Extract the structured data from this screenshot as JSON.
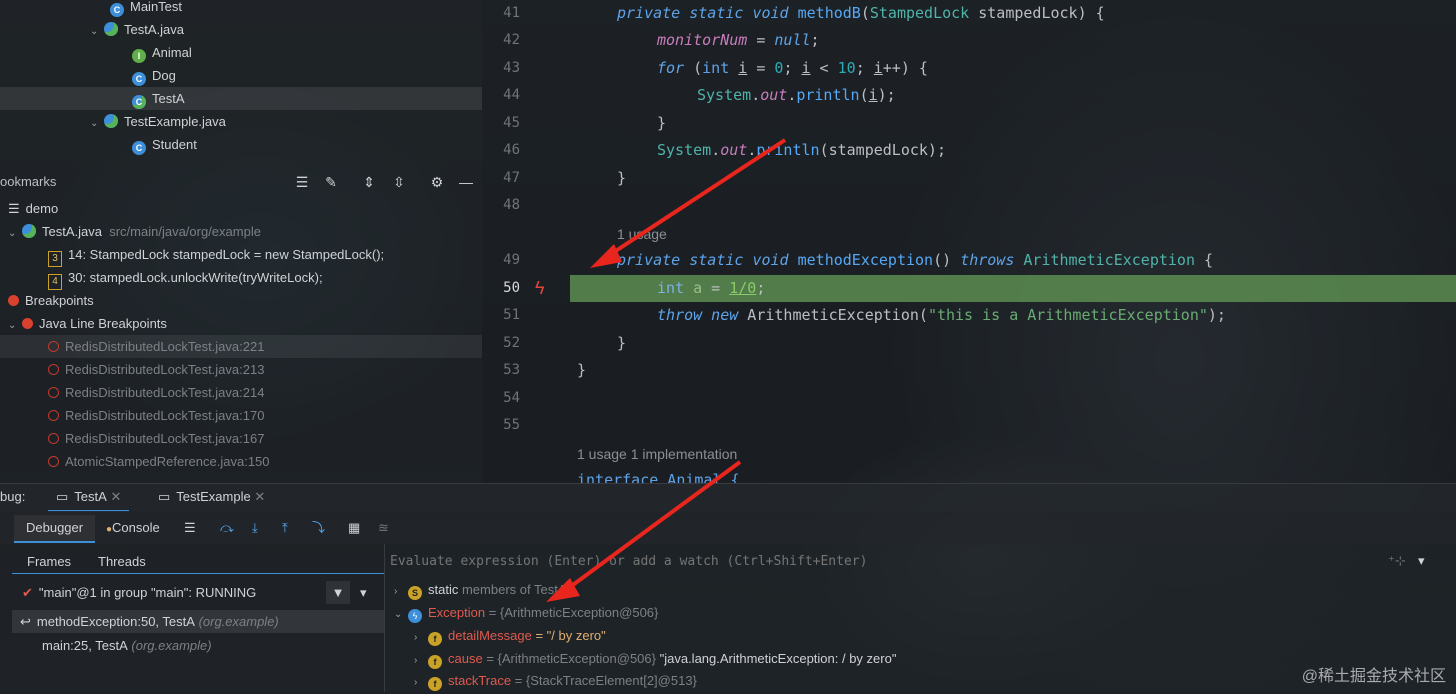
{
  "project_tree": [
    {
      "label": "MainTest",
      "icon": "class-icon",
      "indent": 2,
      "chev": ""
    },
    {
      "label": "TestA.java",
      "icon": "java-file-icon",
      "indent": 1,
      "chev": "v"
    },
    {
      "label": "Animal",
      "icon": "interface-icon",
      "indent": 2,
      "chev": ""
    },
    {
      "label": "Dog",
      "icon": "class-icon",
      "indent": 2,
      "chev": ""
    },
    {
      "label": "TestA",
      "icon": "class-icon",
      "indent": 2,
      "chev": "",
      "selected": true
    },
    {
      "label": "TestExample.java",
      "icon": "java-file-icon",
      "indent": 1,
      "chev": "v"
    },
    {
      "label": "Student",
      "icon": "class-icon",
      "indent": 2,
      "chev": ""
    }
  ],
  "bookmarks": {
    "title": "ookmarks",
    "demo": "demo",
    "file": "TestA.java",
    "file_path": "src/main/java/org/example",
    "entries": [
      {
        "badge": "3",
        "text": "14: StampedLock stampedLock = new StampedLock();"
      },
      {
        "badge": "4",
        "text": "30: stampedLock.unlockWrite(tryWriteLock);"
      }
    ],
    "breakpoints": "Breakpoints",
    "java_line_bp": "Java Line Breakpoints",
    "bp_items": [
      "RedisDistributedLockTest.java:221",
      "RedisDistributedLockTest.java:213",
      "RedisDistributedLockTest.java:214",
      "RedisDistributedLockTest.java:170",
      "RedisDistributedLockTest.java:167",
      "AtomicStampedReference.java:150"
    ]
  },
  "editor": {
    "line_numbers": [
      "41",
      "42",
      "43",
      "44",
      "45",
      "46",
      "47",
      "48",
      "49",
      "50",
      "51",
      "52",
      "53",
      "54",
      "55"
    ],
    "current_line": "50",
    "usage_hint": "1 usage",
    "usage_hint2": "1 usage   1 implementation",
    "last_line_partial": "interface Animal {"
  },
  "debug": {
    "label": "bug:",
    "tabs": [
      "TestA",
      "TestExample"
    ],
    "debugger_tab": "Debugger",
    "console_tab": "Console",
    "frames_tab": "Frames",
    "threads_tab": "Threads",
    "thread": "\"main\"@1 in group \"main\": RUNNING",
    "frames": [
      {
        "method": "methodException:50, TestA",
        "pkg": "(org.example)"
      },
      {
        "method": "main:25, TestA",
        "pkg": "(org.example)"
      }
    ],
    "eval_placeholder": "Evaluate expression (Enter) or add a watch (Ctrl+Shift+Enter)",
    "vars": {
      "static": "static",
      "static_rest": "members of TestA",
      "exception_name": "Exception",
      "exception_val": "= {ArithmeticException@506}",
      "detail_name": "detailMessage",
      "detail_val": "= \"/ by zero\"",
      "cause_name": "cause",
      "cause_val": "= {ArithmeticException@506}",
      "cause_str": "\"java.lang.ArithmeticException: / by zero\"",
      "stack_name": "stackTrace",
      "stack_val": "= {StackTraceElement[2]@513}"
    }
  },
  "watermark": "@稀土掘金技术社区",
  "colors": {
    "accent": "#5ea3e8",
    "current_line": "#629755",
    "breakpoint": "#d9412f",
    "arrow": "#e8261e"
  }
}
